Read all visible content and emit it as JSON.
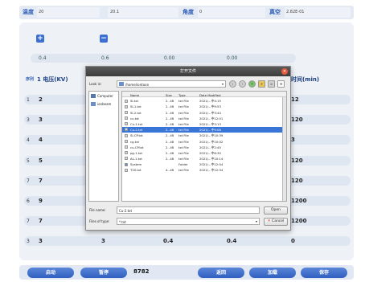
{
  "topbar": {
    "temp_label": "温度",
    "temp_value": "20",
    "temp_value2": "20.1",
    "angle_label": "角度",
    "angle_value": "0",
    "vacuum_label": "真空",
    "vacuum_value": "2.82E-01"
  },
  "controls": {
    "plus_icon": "+",
    "minus_icon": "−",
    "values": [
      "0.4",
      "0.6",
      "0.00",
      "0.00"
    ]
  },
  "table": {
    "header_index": "序列",
    "header_voltage": "1 电压(KV)",
    "header_time": "时间(min)",
    "rows": [
      {
        "num": "1",
        "voltage": "2",
        "time": "12"
      },
      {
        "num": "3",
        "voltage": "3",
        "time": "120"
      },
      {
        "num": "4",
        "voltage": "4",
        "time": "3"
      },
      {
        "num": "5",
        "voltage": "5",
        "time": "120"
      },
      {
        "num": "7",
        "voltage": "7",
        "time": "120"
      },
      {
        "num": "6",
        "voltage": "9",
        "time": "1200"
      },
      {
        "num": "7",
        "voltage": "7",
        "time": "1200"
      }
    ],
    "last_row": {
      "num": "3",
      "voltage": "3",
      "col2": "3",
      "col3": "0.4",
      "col4": "0.4",
      "col5": "0"
    }
  },
  "bottom": {
    "start_label": "启动",
    "pause_label": "暂停",
    "count": "8782",
    "back_label": "返回",
    "load_label": "加载",
    "save_label": "保存"
  },
  "dialog": {
    "title": "打开文件",
    "close_icon": "×",
    "lookin_label": "Look in:",
    "lookin_path": "/home/iontoon",
    "sidebar_items": [
      "Computer",
      "ionbeam"
    ],
    "columns": [
      "Name",
      "Size",
      "Type",
      "Date Modified"
    ],
    "files": [
      {
        "name": "SI.txt",
        "size": "2...tB",
        "type": "txt File",
        "date": "2021/...中4:15"
      },
      {
        "name": "SI-1.txt",
        "size": "2...tB",
        "type": "txt File",
        "date": "2021/...中9:53"
      },
      {
        "name": "SI-2.txt",
        "size": "2...tB",
        "type": "txt File",
        "date": "2021/...中3:44"
      },
      {
        "name": "cu.txt",
        "size": "2...tB",
        "type": "txt File",
        "date": "2021/...中12:01"
      },
      {
        "name": "Cu-1.txt",
        "size": "2...tB",
        "type": "txt File",
        "date": "2021/...中3:13"
      },
      {
        "name": "Cu-2.txt",
        "size": "2...tB",
        "type": "txt File",
        "date": "2021/...中9:08"
      },
      {
        "name": "SI-CP.txt",
        "size": "2...tB",
        "type": "txt File",
        "date": "2021/...中10:39"
      },
      {
        "name": "cg.txt",
        "size": "2...tB",
        "type": "txt File",
        "date": "2021/...中10:02"
      },
      {
        "name": "cu-CP.txt",
        "size": "2...tB",
        "type": "txt File",
        "date": "2021/...中2:45"
      },
      {
        "name": "pg-1.txt",
        "size": "2...tB",
        "type": "txt File",
        "date": "2021/...中6:30"
      },
      {
        "name": "AL-1.txt",
        "size": "2...tB",
        "type": "txt File",
        "date": "2021/...中10:14"
      },
      {
        "name": "System",
        "size": "",
        "type": "Folder",
        "date": "2021/...中12:04"
      },
      {
        "name": "T20.txt",
        "size": "4...tB",
        "type": "txt File",
        "date": "2021/...中12:34"
      }
    ],
    "selected_index": 5,
    "filename_label": "File name:",
    "filename_value": "Cu-2.txt",
    "filetype_label": "Files of type:",
    "filetype_value": "*.txt",
    "open_label": "Open",
    "cancel_label": "Cancel"
  }
}
